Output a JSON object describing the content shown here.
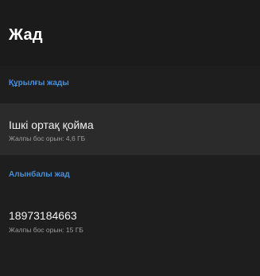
{
  "screen": {
    "title": "Жад"
  },
  "sections": [
    {
      "header": "Құрылғы жады",
      "item": {
        "title": "Ішкі ортақ қойма",
        "subtitle": "Жалпы бос орын: 4,6 ГБ"
      }
    },
    {
      "header": "Алынбалы жад",
      "item": {
        "title": "18973184663",
        "subtitle": "Жалпы бос орын: 15 ГБ"
      }
    }
  ],
  "colors": {
    "accent": "#4a8fd4",
    "background": "#1e1e1e",
    "selected_row": "#2b2b2b",
    "primary_text": "#f2f2f2",
    "secondary_text": "#9b9b9b"
  }
}
